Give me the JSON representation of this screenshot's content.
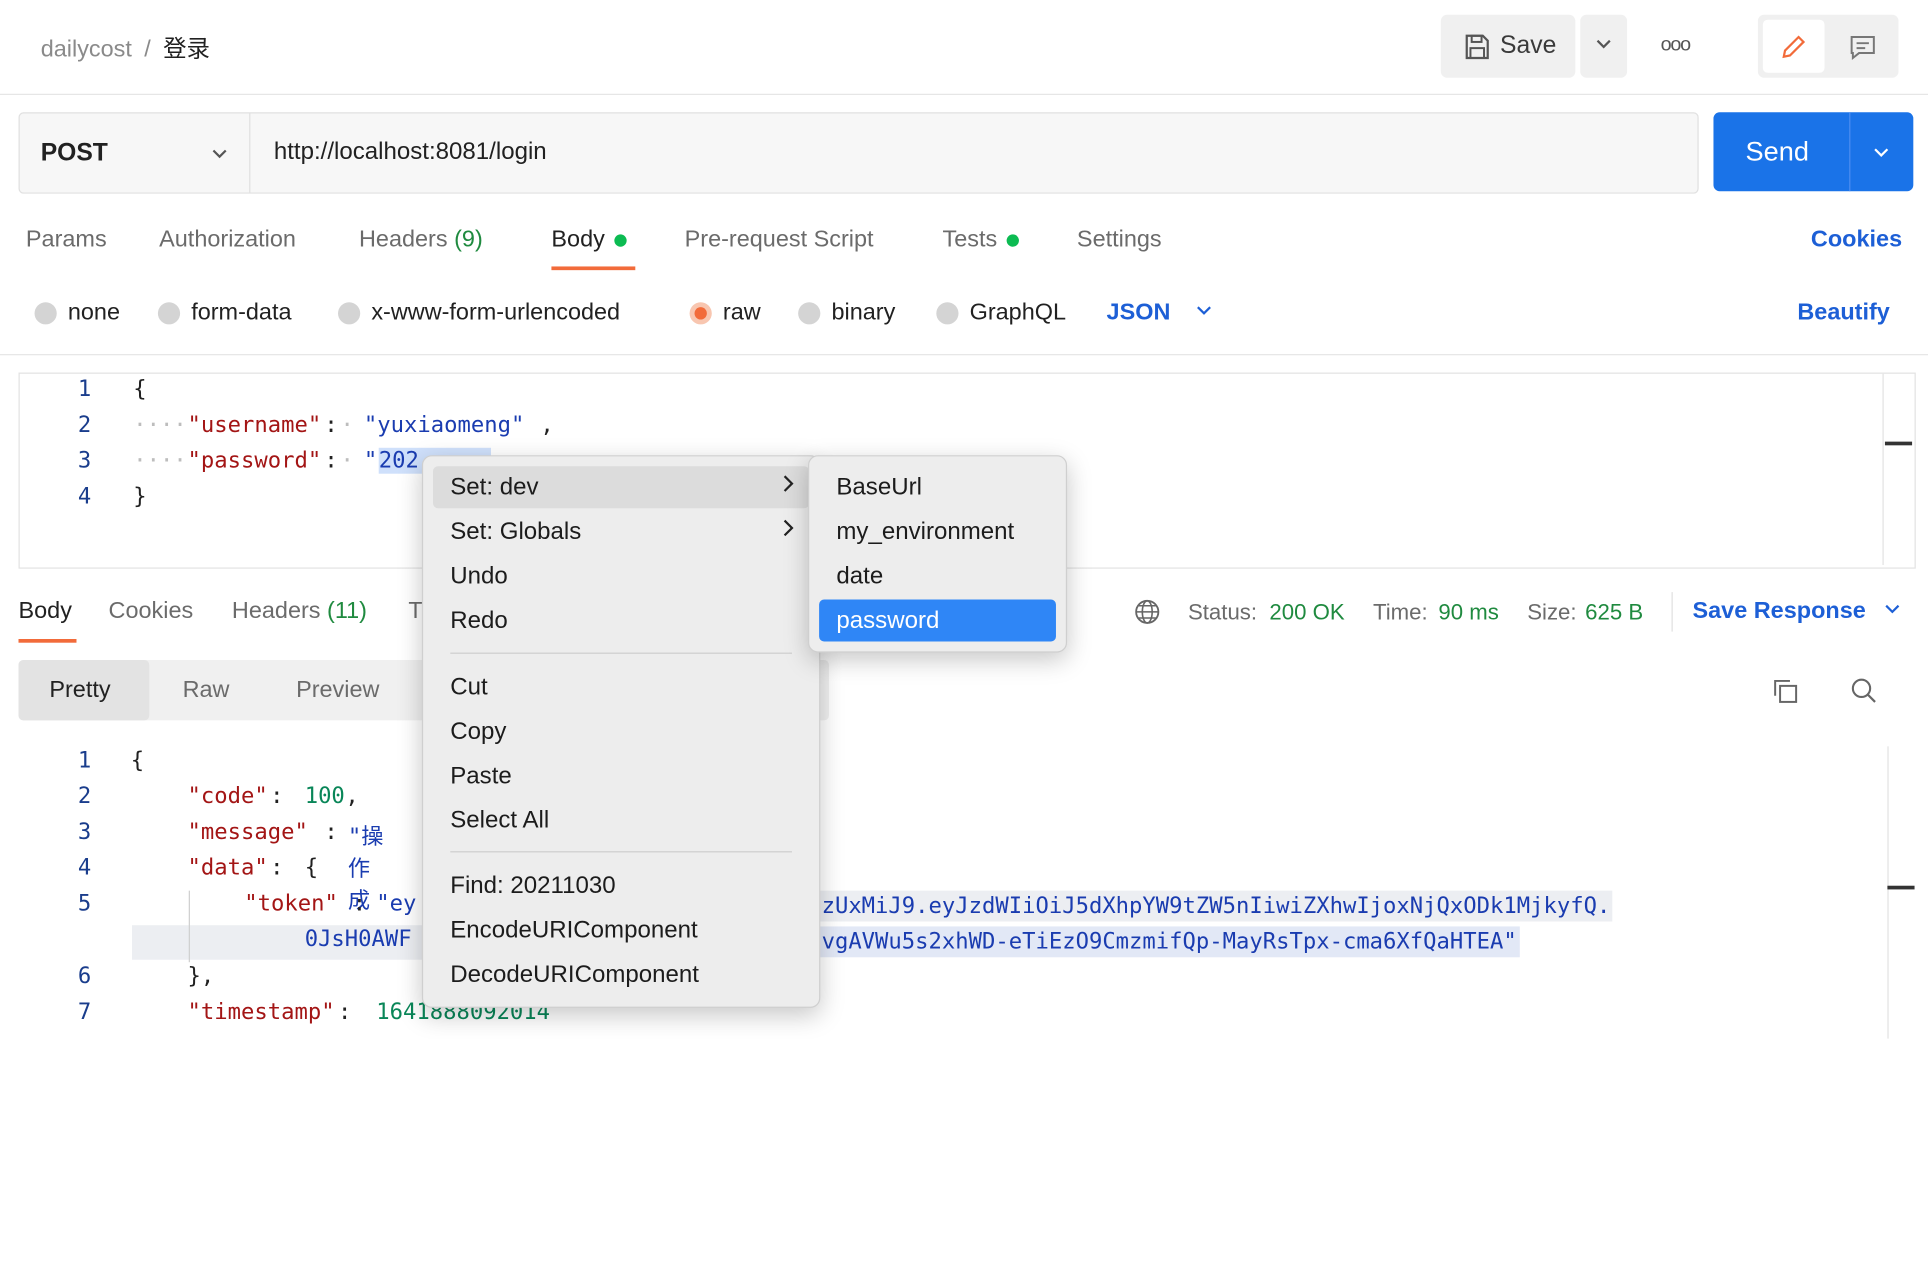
{
  "breadcrumb": {
    "workspace": "dailycost",
    "separator": "/",
    "request": "登录"
  },
  "toolbar": {
    "save_label": "Save",
    "more_label": "ooo"
  },
  "request": {
    "method": "POST",
    "url": "http://localhost:8081/login",
    "send_label": "Send"
  },
  "request_tabs": [
    "Params",
    "Authorization",
    "Headers",
    "Body",
    "Pre-request Script",
    "Tests",
    "Settings"
  ],
  "request_tabs_extra": {
    "headers_count": "(9)",
    "cookies": "Cookies"
  },
  "body_types": [
    "none",
    "form-data",
    "x-www-form-urlencoded",
    "raw",
    "binary",
    "GraphQL"
  ],
  "body_format": "JSON",
  "beautify_label": "Beautify",
  "request_body": {
    "line_numbers": [
      "1",
      "2",
      "3",
      "4"
    ],
    "open_brace": "{",
    "close_brace": "}",
    "username_key": "\"username\"",
    "username_value": "\"yuxiaomeng\"",
    "password_key": "\"password\"",
    "password_value_open": "\"",
    "password_value_visible": "202"
  },
  "response_tabs": [
    "Body",
    "Cookies",
    "Headers",
    "T"
  ],
  "response_extra": {
    "headers_count": "(11)"
  },
  "response_status": {
    "status_label": "Status:",
    "status_value": "200 OK",
    "time_label": "Time:",
    "time_value": "90 ms",
    "size_label": "Size:",
    "size_value": "625 B",
    "save_response": "Save Response"
  },
  "view_modes": [
    "Pretty",
    "Raw",
    "Preview"
  ],
  "response_body": {
    "line_numbers": [
      "1",
      "2",
      "3",
      "4",
      "5",
      "",
      "6",
      "7"
    ],
    "open_brace": "{",
    "code_key": "\"code\"",
    "code_value": "100",
    "message_key": "\"message\"",
    "message_value_partial": "\"操作成",
    "data_key": "\"data\"",
    "token_key": "\"token\"",
    "token_start": "\"ey",
    "token_line1_tail": "zUxMiJ9.eyJzdWIiOiJ5dXhpYW9tZW5nIiwiZXhwIjoxNjQxODk1MjkyfQ.",
    "token_line2_start": "0JsH0AWF",
    "token_line2_tail": "vgAVWu5s2xhWD-eTiEzO9CmzmifQp-MayRsTpx-cma6XfQaHTEA\"",
    "data_close": "},",
    "timestamp_key": "\"timestamp\"",
    "timestamp_value": "1641888092014"
  },
  "context_menu": {
    "items": [
      "Set: dev",
      "Set: Globals",
      "Undo",
      "Redo",
      "Cut",
      "Copy",
      "Paste",
      "Select All",
      "Find: 20211030",
      "EncodeURIComponent",
      "DecodeURIComponent"
    ],
    "submenu": [
      "BaseUrl",
      "my_environment",
      "date",
      "password"
    ]
  },
  "colors": {
    "accent": "#1a73e8",
    "status_green": "#1f8a3f",
    "active_tab_underline": "#f26b3a",
    "menu_highlight": "#2f86f6"
  },
  "icons": [
    "save-icon",
    "chevron-down-icon",
    "pencil-icon",
    "comment-icon",
    "globe-icon",
    "copy-icon",
    "search-icon"
  ]
}
